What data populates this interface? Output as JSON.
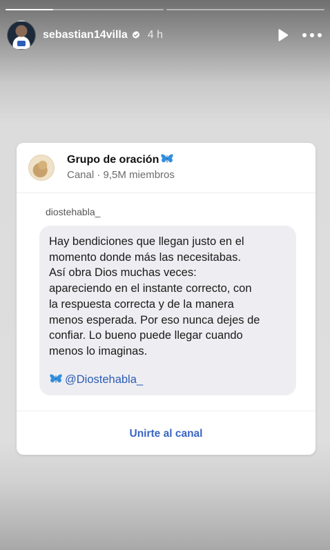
{
  "story": {
    "progress": [
      1,
      0,
      0
    ],
    "progress_first_fill_fraction": 0.3
  },
  "header": {
    "username": "sebastian14villa",
    "time": "4 h",
    "icons": {
      "verified": "verified-badge-icon",
      "play": "play-icon",
      "more": "more-options-icon"
    }
  },
  "card": {
    "channel_name": "Grupo de oración",
    "channel_meta": "Canal · 9,5M miembros",
    "sender": "diostehabla_",
    "message": "Hay bendiciones que llegan justo en el\nmomento donde más las necesitabas.\nAsí obra Dios muchas veces:\napareciendo en el instante correcto, con\nla respuesta correcta y de la manera\nmenos esperada. Por eso nunca dejes de\nconfiar. Lo bueno puede llegar cuando\nmenos lo imaginas.",
    "mention": "@Diostehabla_",
    "join_label": "Unirte al canal",
    "accent_color": "#3a65c4",
    "butterfly_color": "#2f8fe0"
  }
}
